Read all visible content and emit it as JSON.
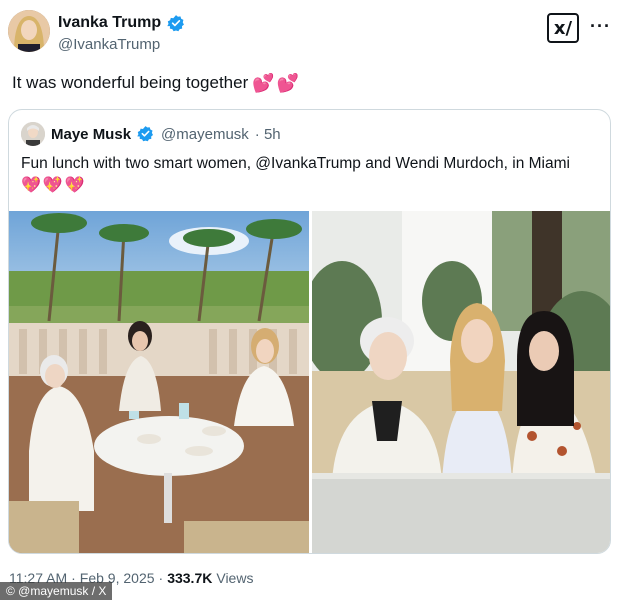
{
  "author": {
    "display_name": "Ivanka Trump",
    "handle": "@IvankaTrump",
    "verified_icon": "verified-badge-icon"
  },
  "tweet": {
    "text": "It was wonderful being together",
    "emoji": "💕💕"
  },
  "quoted": {
    "display_name": "Maye Musk",
    "handle": "@mayemusk",
    "time": "· 5h",
    "text": "Fun lunch with two smart women, @IvankaTrump and Wendi Murdoch, in Miami",
    "emoji": "💖💖💖"
  },
  "meta": {
    "time": "11:27 AM",
    "sep1": "·",
    "date": "Feb 9, 2025",
    "sep2": "·",
    "views_count": "333.7K",
    "views_label": "Views"
  },
  "toolbar": {
    "grok_label": "x/",
    "more_label": "···"
  },
  "watermark": "© @mayemusk / X",
  "colors": {
    "brand_blue": "#1d9bf0",
    "text": "#0f1419",
    "muted": "#536471",
    "heart": "#e0245e"
  }
}
